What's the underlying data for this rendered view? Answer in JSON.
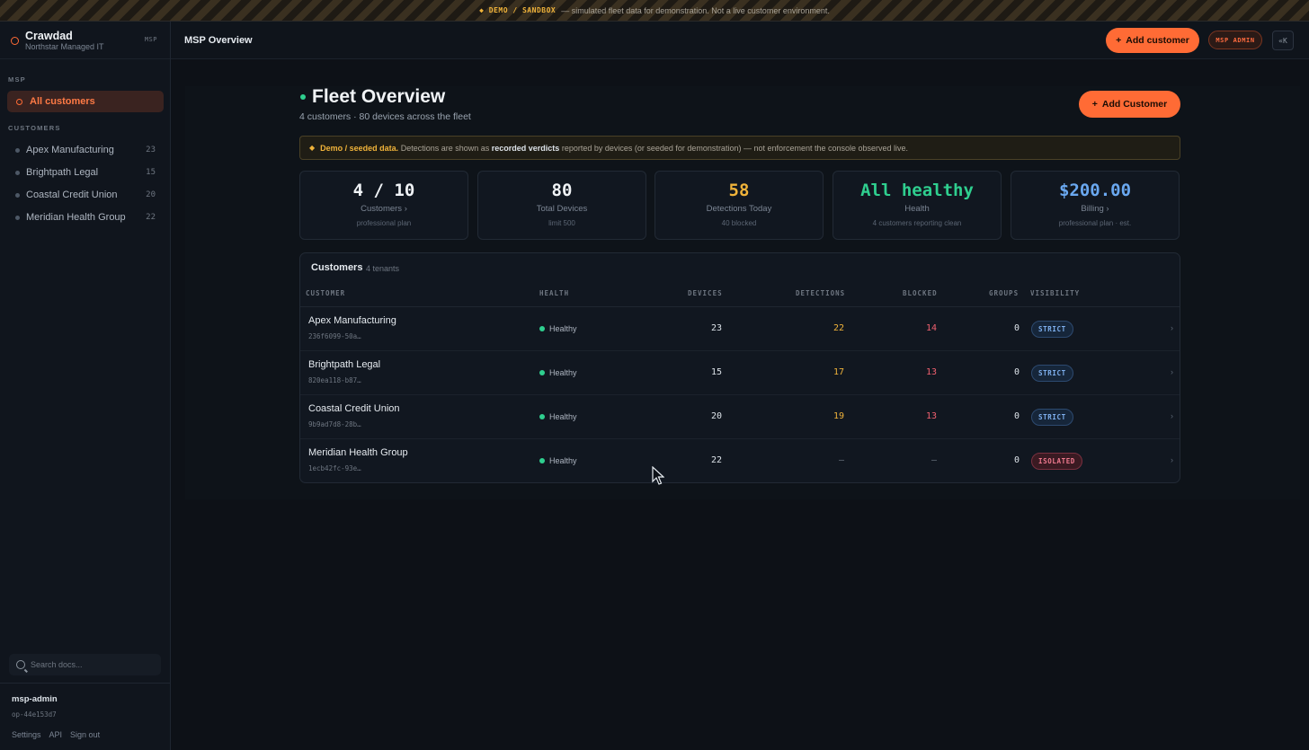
{
  "banner": {
    "tag": "◆ DEMO / SANDBOX",
    "message": "— simulated fleet data for demonstration. Not a live customer environment."
  },
  "sidebar": {
    "brand": "Crawdad",
    "org": "Northstar Managed IT",
    "scope_badge": "MSP",
    "section_msp": "MSP",
    "all_customers": "All customers",
    "section_customers": "CUSTOMERS",
    "customers": [
      {
        "name": "Apex Manufacturing",
        "count": "23"
      },
      {
        "name": "Brightpath Legal",
        "count": "15"
      },
      {
        "name": "Coastal Credit Union",
        "count": "20"
      },
      {
        "name": "Meridian Health Group",
        "count": "22"
      }
    ],
    "search_placeholder": "Search docs...",
    "user": {
      "name": "msp-admin",
      "id": "op-44e153d7"
    },
    "links": [
      "Settings",
      "API",
      "Sign out"
    ]
  },
  "topbar": {
    "title": "MSP Overview",
    "add_customer": "Add customer",
    "role_badge": "MSP ADMIN",
    "collapse": "«K"
  },
  "main": {
    "title": "Fleet Overview",
    "subtitle": "4 customers · 80 devices across the fleet",
    "add_customer": "Add Customer",
    "notice": {
      "lead": "Demo / seeded data.",
      "text1": "Detections are shown as",
      "highlight": "recorded verdicts",
      "text2": "reported by devices (or seeded for demonstration) — not enforcement the console observed live."
    },
    "stats": [
      {
        "value": "4 / 10",
        "label": "Customers ›",
        "sub": "professional plan",
        "color": "#f0f3f6"
      },
      {
        "value": "80",
        "label": "Total Devices",
        "sub": "limit 500",
        "color": "#f0f3f6"
      },
      {
        "value": "58",
        "label": "Detections Today",
        "sub": "40 blocked",
        "color": "#f0b33a"
      },
      {
        "value": "All healthy",
        "label": "Health",
        "sub": "4 customers reporting clean",
        "color": "#2fcf8f"
      },
      {
        "value": "$200.00",
        "label": "Billing ›",
        "sub": "professional plan · est.",
        "color": "#6aa8f0"
      }
    ],
    "table": {
      "title": "Customers",
      "count": "4 tenants",
      "headers": {
        "customer": "CUSTOMER",
        "health": "HEALTH",
        "devices": "DEVICES",
        "detections": "DETECTIONS",
        "blocked": "BLOCKED",
        "groups": "GROUPS",
        "visibility": "VISIBILITY"
      },
      "rows": [
        {
          "name": "Apex Manufacturing",
          "id": "236f6099-50a…",
          "health": "Healthy",
          "devices": "23",
          "detections": "22",
          "blocked": "14",
          "groups": "0",
          "visibility": "STRICT"
        },
        {
          "name": "Brightpath Legal",
          "id": "820ea118-b87…",
          "health": "Healthy",
          "devices": "15",
          "detections": "17",
          "blocked": "13",
          "groups": "0",
          "visibility": "STRICT"
        },
        {
          "name": "Coastal Credit Union",
          "id": "9b9ad7d8-28b…",
          "health": "Healthy",
          "devices": "20",
          "detections": "19",
          "blocked": "13",
          "groups": "0",
          "visibility": "STRICT"
        },
        {
          "name": "Meridian Health Group",
          "id": "1ecb42fc-93e…",
          "health": "Healthy",
          "devices": "22",
          "detections": "–",
          "blocked": "–",
          "groups": "0",
          "visibility": "ISOLATED"
        }
      ]
    }
  }
}
